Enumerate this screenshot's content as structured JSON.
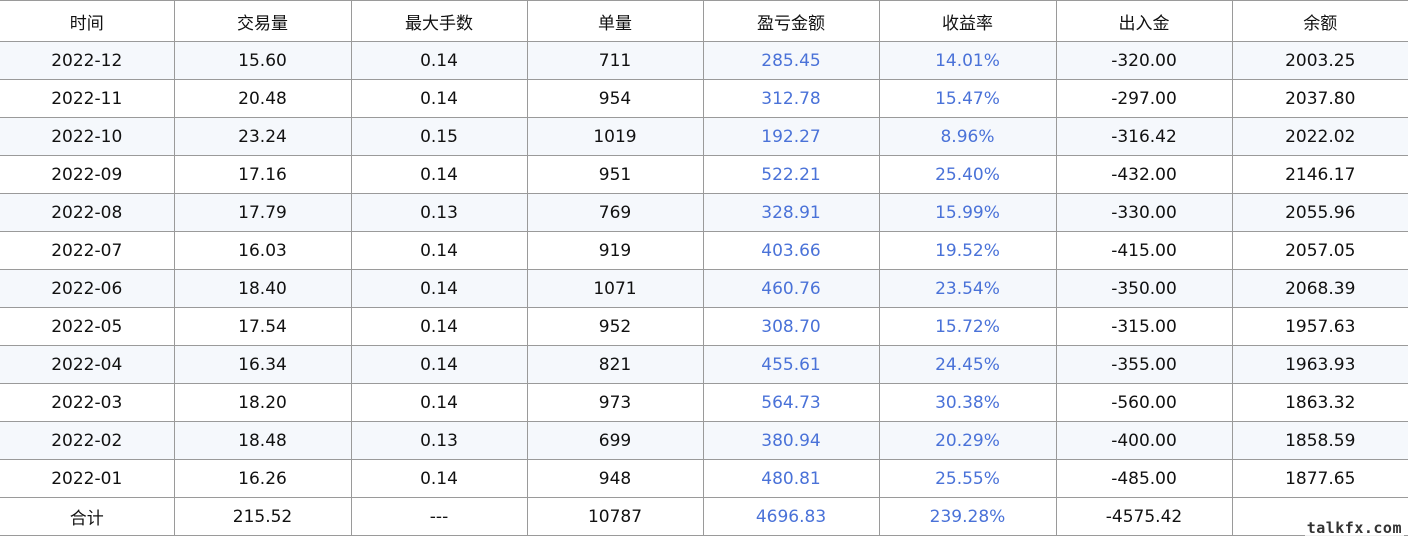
{
  "table": {
    "headers": [
      "时间",
      "交易量",
      "最大手数",
      "单量",
      "盈亏金额",
      "收益率",
      "出入金",
      "余额"
    ],
    "rows": [
      [
        "2022-12",
        "15.60",
        "0.14",
        "711",
        "285.45",
        "14.01%",
        "-320.00",
        "2003.25"
      ],
      [
        "2022-11",
        "20.48",
        "0.14",
        "954",
        "312.78",
        "15.47%",
        "-297.00",
        "2037.80"
      ],
      [
        "2022-10",
        "23.24",
        "0.15",
        "1019",
        "192.27",
        "8.96%",
        "-316.42",
        "2022.02"
      ],
      [
        "2022-09",
        "17.16",
        "0.14",
        "951",
        "522.21",
        "25.40%",
        "-432.00",
        "2146.17"
      ],
      [
        "2022-08",
        "17.79",
        "0.13",
        "769",
        "328.91",
        "15.99%",
        "-330.00",
        "2055.96"
      ],
      [
        "2022-07",
        "16.03",
        "0.14",
        "919",
        "403.66",
        "19.52%",
        "-415.00",
        "2057.05"
      ],
      [
        "2022-06",
        "18.40",
        "0.14",
        "1071",
        "460.76",
        "23.54%",
        "-350.00",
        "2068.39"
      ],
      [
        "2022-05",
        "17.54",
        "0.14",
        "952",
        "308.70",
        "15.72%",
        "-315.00",
        "1957.63"
      ],
      [
        "2022-04",
        "16.34",
        "0.14",
        "821",
        "455.61",
        "24.45%",
        "-355.00",
        "1963.93"
      ],
      [
        "2022-03",
        "18.20",
        "0.14",
        "973",
        "564.73",
        "30.38%",
        "-560.00",
        "1863.32"
      ],
      [
        "2022-02",
        "18.48",
        "0.13",
        "699",
        "380.94",
        "20.29%",
        "-400.00",
        "1858.59"
      ],
      [
        "2022-01",
        "16.26",
        "0.14",
        "948",
        "480.81",
        "25.55%",
        "-485.00",
        "1877.65"
      ]
    ],
    "total": [
      "合计",
      "215.52",
      "---",
      "10787",
      "4696.83",
      "239.28%",
      "-4575.42",
      ""
    ]
  },
  "watermark": "talkfx.com",
  "colors": {
    "positive_value": "#4a72d8",
    "zebra_row": "#f5f8fc",
    "grid_line": "#9a9a9a",
    "text": "#111111"
  }
}
